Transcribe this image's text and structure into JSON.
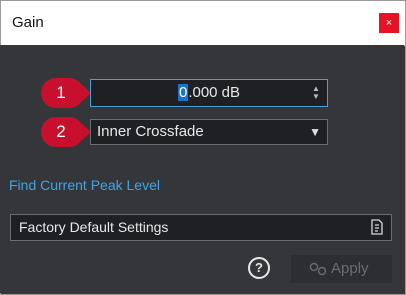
{
  "window": {
    "title": "Gain",
    "close_glyph": "×"
  },
  "callouts": [
    {
      "label": "1"
    },
    {
      "label": "2"
    }
  ],
  "gain_field": {
    "value_selected": "0",
    "value_rest": ".000 dB",
    "stepper_up": "▲",
    "stepper_down": "▼"
  },
  "mode_select": {
    "value": "Inner Crossfade",
    "arrow": "▼"
  },
  "links": {
    "find_peak": "Find Current Peak Level"
  },
  "preset": {
    "label": "Factory Default Settings",
    "icon": "preset-document-icon"
  },
  "footer": {
    "help_glyph": "?",
    "apply_label": "Apply",
    "apply_icon": "apply-link-icon"
  },
  "colors": {
    "accent": "#3ea6e8",
    "callout": "#c8102e",
    "close": "#e81123",
    "background": "#34363a"
  }
}
